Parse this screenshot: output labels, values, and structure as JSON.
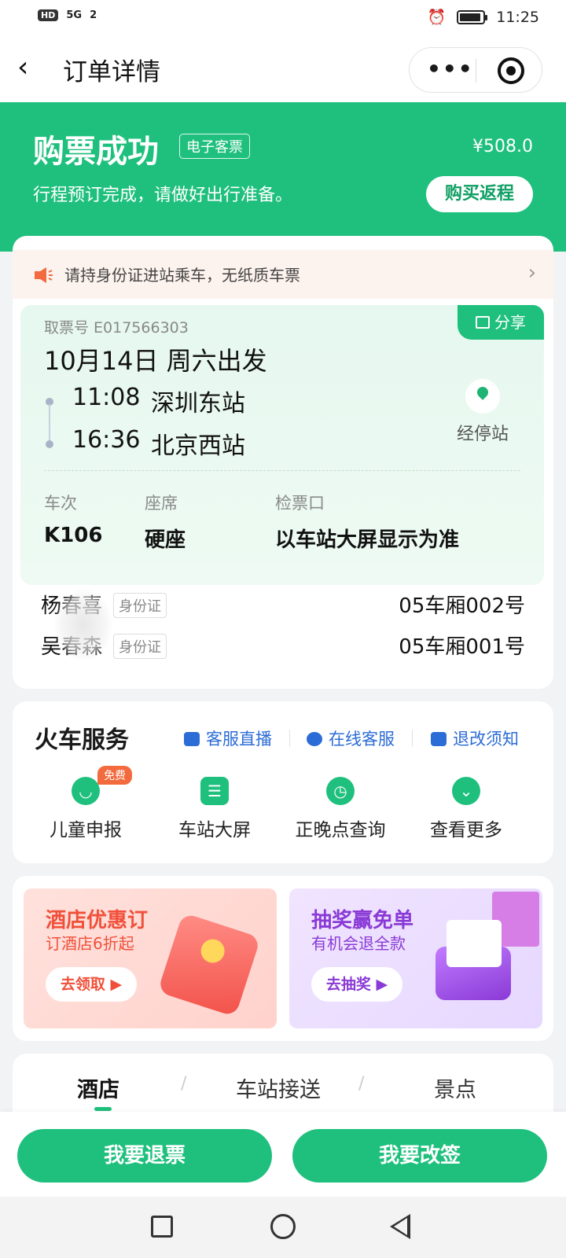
{
  "status_bar": {
    "network": "HD",
    "signal": "5G",
    "wifi_badge": "2",
    "time": "11:25"
  },
  "nav": {
    "title": "订单详情"
  },
  "hero": {
    "title": "购票成功",
    "badge": "电子客票",
    "price": "¥508.0",
    "subtitle": "行程预订完成，请做好出行准备。",
    "return_button": "购买返程"
  },
  "notice": {
    "text": "请持身份证进站乘车，无纸质车票"
  },
  "ticket": {
    "pickup_label": "取票号 E017566303",
    "share_label": "分享",
    "date": "10月14日 周六出发",
    "depart_time": "11:08",
    "depart_station": "深圳东站",
    "arrive_time": "16:36",
    "arrive_station": "北京西站",
    "stops_label": "经停站",
    "train_header": "车次",
    "train_value": "K106",
    "seat_header": "座席",
    "seat_value": "硬座",
    "gate_header": "检票口",
    "gate_value": "以车站大屏显示为准"
  },
  "passengers": [
    {
      "name": "杨春喜",
      "id_type": "身份证",
      "seat": "05车厢002号"
    },
    {
      "name": "吴春森",
      "id_type": "身份证",
      "seat": "05车厢001号"
    }
  ],
  "services": {
    "title": "火车服务",
    "links": [
      "客服直播",
      "在线客服",
      "退改须知"
    ],
    "items": [
      {
        "label": "儿童申报",
        "badge": "免费"
      },
      {
        "label": "车站大屏"
      },
      {
        "label": "正晚点查询"
      },
      {
        "label": "查看更多"
      }
    ]
  },
  "promos": [
    {
      "title": "酒店优惠订",
      "subtitle": "订酒店6折起",
      "button": "去领取 ▶"
    },
    {
      "title": "抽奖赢免单",
      "subtitle": "有机会退全款",
      "button": "去抽奖 ▶"
    }
  ],
  "tabs": [
    "酒店",
    "车站接送",
    "景点"
  ],
  "bottom_actions": {
    "refund": "我要退票",
    "change": "我要改签"
  },
  "colors": {
    "accent": "#1fc07d",
    "link": "#2c6cd6",
    "promo_red": "#f0503a",
    "promo_purple": "#8a3ad6"
  }
}
